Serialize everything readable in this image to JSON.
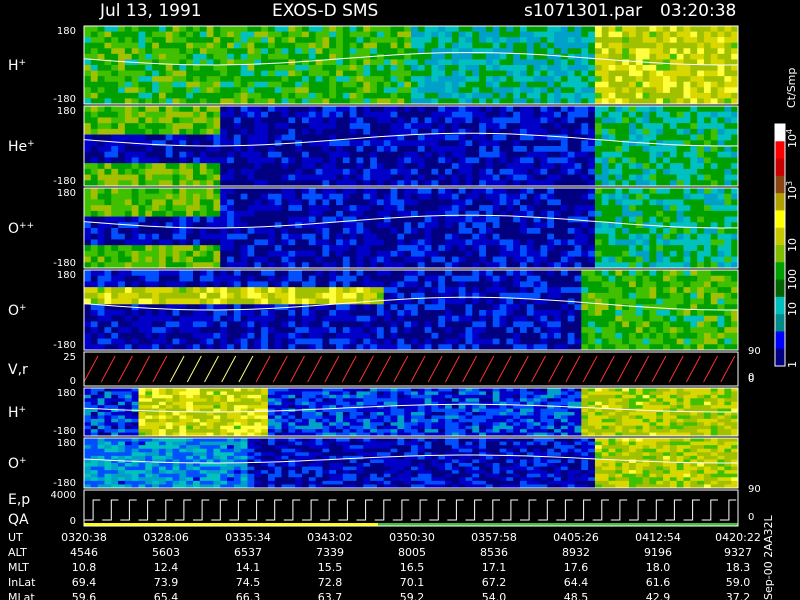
{
  "header": {
    "date": "Jul 13, 1991",
    "instrument": "EXOS-D SMS",
    "file": "s1071301.par",
    "time": "03:20:38"
  },
  "colorbar": {
    "unit": "Ct/Smp",
    "tick_labels": [
      "10",
      "10",
      "10",
      "100",
      "10",
      "1"
    ],
    "superscripts": [
      "4",
      "3"
    ],
    "zero_label": "0",
    "colors": [
      "#ffffff",
      "#ff0000",
      "#c80000",
      "#8b4513",
      "#b0a000",
      "#ffff00",
      "#c8c800",
      "#7fbf00",
      "#00a000",
      "#006400",
      "#00bfbf",
      "#008b8b",
      "#0000ff",
      "#000080"
    ]
  },
  "side_text": "Sep-00 2AA32L",
  "chart_data": [
    {
      "type": "heatmap",
      "panel": "H+",
      "ylabel": "H+",
      "ylim": [
        -180,
        180
      ],
      "y_tick_labels": [
        "180",
        "-180"
      ],
      "x": [
        "0320:38",
        "0328:06",
        "0335:34",
        "0343:02",
        "0350:30",
        "0357:58",
        "0405:26",
        "0412:54",
        "0420:22"
      ]
    },
    {
      "type": "heatmap",
      "panel": "He+",
      "ylabel": "He+",
      "ylim": [
        -180,
        180
      ],
      "y_tick_labels": [
        "180",
        "-180"
      ]
    },
    {
      "type": "heatmap",
      "panel": "O++",
      "ylabel": "O++",
      "ylim": [
        -180,
        180
      ],
      "y_tick_labels": [
        "180",
        "-180"
      ]
    },
    {
      "type": "heatmap",
      "panel": "O+",
      "ylabel": "O+",
      "ylim": [
        -180,
        180
      ],
      "y_tick_labels": [
        "180",
        "-180"
      ],
      "right_label": "90"
    },
    {
      "type": "line",
      "panel": "V,r",
      "ylabel": "V,r",
      "ylim": [
        0,
        25
      ],
      "y_tick_labels": [
        "25",
        "0"
      ],
      "right_label": "0"
    },
    {
      "type": "heatmap",
      "panel": "H+ (lower)",
      "ylabel": "H+",
      "ylim": [
        -180,
        180
      ],
      "y_tick_labels": [
        "180",
        "-180"
      ]
    },
    {
      "type": "heatmap",
      "panel": "O+ (lower)",
      "ylabel": "O+",
      "ylim": [
        -180,
        180
      ],
      "y_tick_labels": [
        "180",
        "-180"
      ],
      "right_label": "90"
    },
    {
      "type": "line",
      "panel": "E,p / QA",
      "ylabel_top": "E,p",
      "ylabel_bottom": "QA",
      "ylim": [
        0,
        4000
      ],
      "y_tick_labels": [
        "4000",
        "0"
      ],
      "right_label": "0"
    },
    {
      "type": "table",
      "rows": [
        {
          "label": "UT",
          "values": [
            "0320:38",
            "0328:06",
            "0335:34",
            "0343:02",
            "0350:30",
            "0357:58",
            "0405:26",
            "0412:54",
            "0420:22"
          ]
        },
        {
          "label": "ALT",
          "values": [
            "4546",
            "5603",
            "6537",
            "7339",
            "8005",
            "8536",
            "8932",
            "9196",
            "9327"
          ]
        },
        {
          "label": "MLT",
          "values": [
            "10.8",
            "12.4",
            "14.1",
            "15.5",
            "16.5",
            "17.1",
            "17.6",
            "18.0",
            "18.3"
          ]
        },
        {
          "label": "InLat",
          "values": [
            "69.4",
            "73.9",
            "74.5",
            "72.8",
            "70.1",
            "67.2",
            "64.4",
            "61.6",
            "59.0"
          ]
        },
        {
          "label": "MLat",
          "values": [
            "59.6",
            "65.4",
            "66.3",
            "63.7",
            "59.2",
            "54.0",
            "48.5",
            "42.9",
            "37.2"
          ]
        }
      ]
    }
  ]
}
